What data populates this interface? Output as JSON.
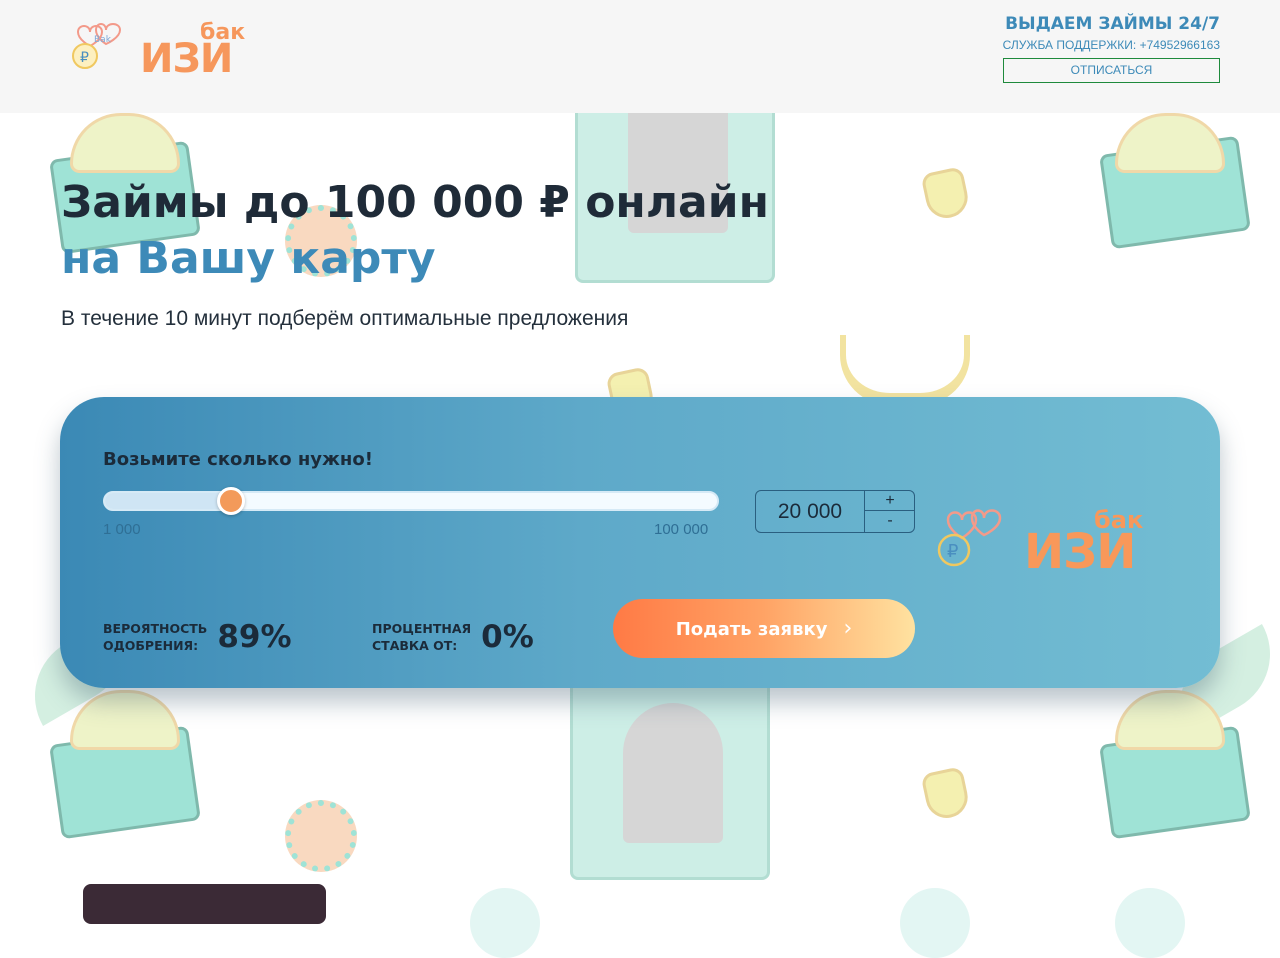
{
  "header": {
    "logo_word": "ИЗИ",
    "logo_sup": "бак",
    "headline": "ВЫДАЕМ ЗАЙМЫ 24/7",
    "support_text": "СЛУЖБА ПОДДЕРЖКИ: +74952966163",
    "unsubscribe_label": "ОТПИСАТЬСЯ"
  },
  "hero": {
    "title_line1": "Займы до 100 000 ₽ онлайн",
    "title_line2": "на Вашу карту",
    "subtitle": "В течение 10 минут подберём оптимальные предложения"
  },
  "calculator": {
    "label": "Возьмите сколько нужно!",
    "min_label": "1 000",
    "max_label": "100 000",
    "slider_min": 1000,
    "slider_max": 100000,
    "slider_value": 20000,
    "amount_value": "20 000",
    "plus_label": "+",
    "minus_label": "-",
    "logo_word": "ИЗИ",
    "logo_sup": "бак",
    "approval_label_line1": "ВЕРОЯТНОСТЬ",
    "approval_label_line2": "ОДОБРЕНИЯ:",
    "approval_value": "89%",
    "rate_label_line1": "ПРОЦЕНТНАЯ",
    "rate_label_line2": "СТАВКА ОТ:",
    "rate_value": "0%",
    "submit_label": "Подать заявку"
  },
  "colors": {
    "accent_blue": "#3d8ab8",
    "accent_orange": "#f6975c",
    "header_bg": "#f6f6f6"
  }
}
